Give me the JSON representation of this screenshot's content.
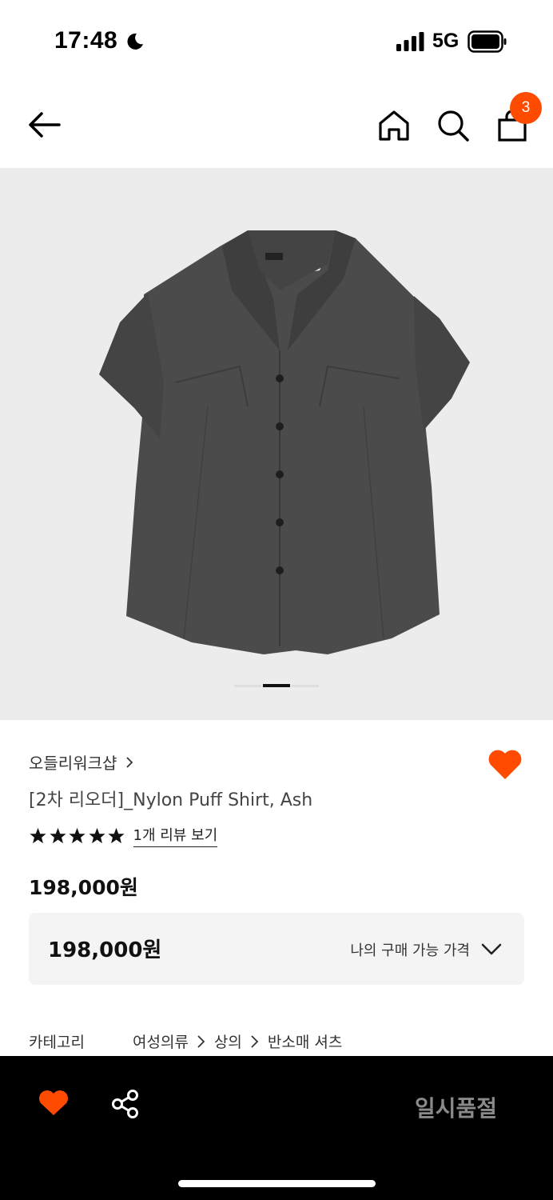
{
  "status_bar": {
    "time": "17:48",
    "network": "5G"
  },
  "header": {
    "cart_count": "3"
  },
  "gallery": {
    "pages": 3,
    "active_page": 2
  },
  "product": {
    "brand": "오들리워크샵",
    "title": "[2차 리오더]_Nylon Puff Shirt, Ash",
    "rating": 5,
    "review_link": "1개 리뷰 보기",
    "price": "198,000원",
    "my_price_amount": "198,000원",
    "my_price_label": "나의 구매 가능 가격",
    "category_label": "카테고리",
    "category_path": [
      "여성의류",
      "상의",
      "반소매 셔츠"
    ],
    "wished": true
  },
  "bottom_bar": {
    "status_label": "일시품절"
  },
  "colors": {
    "accent": "#ff4b00",
    "bottom_bar_bg": "#000000",
    "gallery_bg": "#ececec"
  },
  "icons": [
    "back-arrow-icon",
    "home-icon",
    "search-icon",
    "shopping-bag-icon",
    "heart-icon",
    "share-icon",
    "chevron-right-icon",
    "chevron-down-icon",
    "star-icon",
    "moon-icon",
    "signal-icon",
    "battery-icon"
  ]
}
